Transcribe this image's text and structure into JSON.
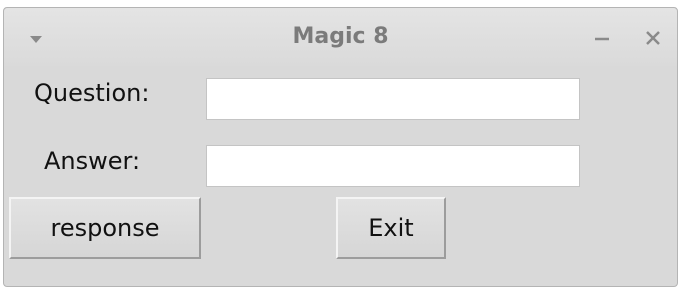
{
  "window": {
    "title": "Magic 8",
    "menu_icon": "dropdown-arrow-icon",
    "minimize_icon": "minimize-icon",
    "close_icon": "close-icon"
  },
  "form": {
    "question_label": "Question:",
    "question_value": "",
    "answer_label": "Answer:",
    "answer_value": ""
  },
  "buttons": {
    "response_label": "response",
    "exit_label": "Exit"
  },
  "colors": {
    "window_background": "#d9d9d9",
    "title_text": "#7b7b7b",
    "entry_background": "#ffffff"
  }
}
